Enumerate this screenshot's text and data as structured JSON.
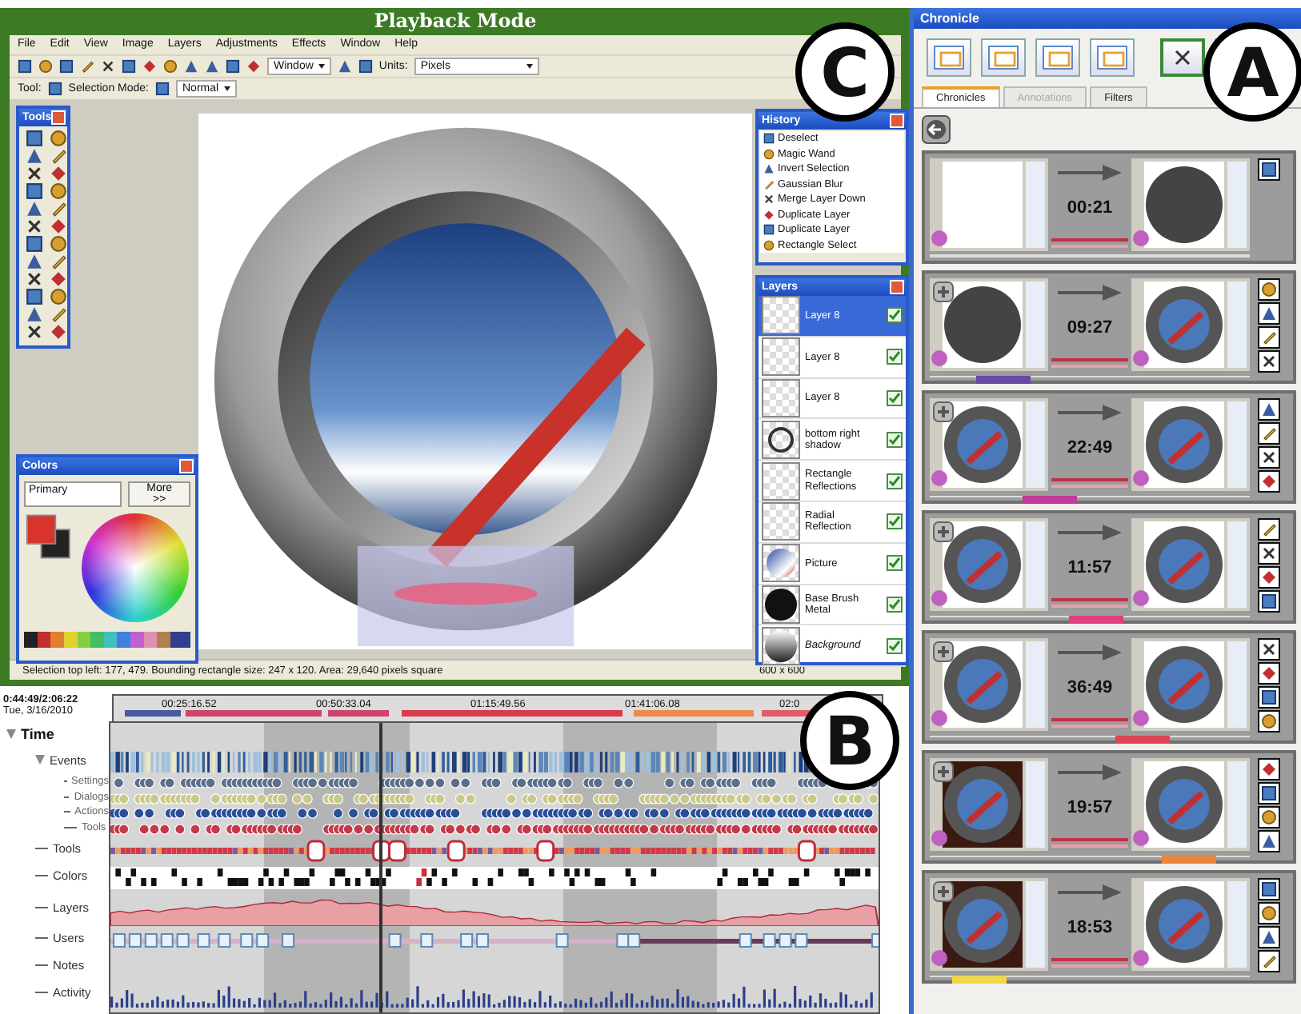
{
  "app": {
    "title": "Playback Mode",
    "menu": [
      "File",
      "Edit",
      "View",
      "Image",
      "Layers",
      "Adjustments",
      "Effects",
      "Window",
      "Help"
    ],
    "zoom_select": "Window",
    "units_label": "Units:",
    "units_select": "Pixels",
    "tool_label": "Tool:",
    "selection_mode_label": "Selection Mode:",
    "blend_select": "Normal",
    "tools_panel": {
      "title": "Tools"
    },
    "colors_panel": {
      "title": "Colors",
      "mode_select": "Primary",
      "more_button": "More >>"
    },
    "history_panel": {
      "title": "History",
      "items": [
        "Deselect",
        "Magic Wand",
        "Invert Selection",
        "Gaussian Blur",
        "Merge Layer Down",
        "Duplicate Layer",
        "Duplicate Layer",
        "Rectangle Select"
      ]
    },
    "layers_panel": {
      "title": "Layers",
      "layers": [
        {
          "name": "Layer 8",
          "selected": true,
          "visible": true,
          "kind": "layer"
        },
        {
          "name": "Layer 8",
          "selected": false,
          "visible": true,
          "kind": "layer"
        },
        {
          "name": "Layer 8",
          "selected": false,
          "visible": true,
          "kind": "layer"
        },
        {
          "name": "bottom right shadow",
          "selected": false,
          "visible": true,
          "kind": "ring"
        },
        {
          "name": "Rectangle Reflections",
          "selected": false,
          "visible": true,
          "kind": "layer"
        },
        {
          "name": "Radial Reflection",
          "selected": false,
          "visible": true,
          "kind": "layer"
        },
        {
          "name": "Picture",
          "selected": false,
          "visible": true,
          "kind": "picture"
        },
        {
          "name": "Base Brush Metal",
          "selected": false,
          "visible": true,
          "kind": "disc"
        },
        {
          "name": "Background",
          "selected": false,
          "visible": true,
          "kind": "background"
        }
      ]
    },
    "status_bar": {
      "selection_info": "Selection top left: 177, 479. Bounding rectangle size: 247 x 120. Area: 29,640 pixels square",
      "image_size": "600 x 600"
    }
  },
  "timeline": {
    "current_time": "0:44:49/2:06:22",
    "date": "Tue, 3/16/2010",
    "ticks": [
      "00:25:16.52",
      "00:50:33.04",
      "01:15:49.56",
      "01:41:06.08",
      "02:0"
    ],
    "tracks": [
      {
        "label": "Time",
        "kind": "group",
        "expanded": true,
        "children": [
          {
            "label": "Events",
            "kind": "events",
            "expanded": true,
            "children": [
              {
                "label": "Settings",
                "kind": "dots"
              },
              {
                "label": "Dialogs",
                "kind": "dots"
              },
              {
                "label": "Actions",
                "kind": "dots"
              },
              {
                "label": "Tools",
                "kind": "dots"
              }
            ]
          },
          {
            "label": "Tools",
            "kind": "tools"
          },
          {
            "label": "Colors",
            "kind": "colors"
          },
          {
            "label": "Layers",
            "kind": "layers"
          },
          {
            "label": "Users",
            "kind": "users"
          },
          {
            "label": "Notes",
            "kind": "notes"
          },
          {
            "label": "Activity",
            "kind": "activity"
          }
        ]
      }
    ]
  },
  "chronicle": {
    "title": "Chronicle",
    "tabs": [
      {
        "label": "Chronicles",
        "selected": true,
        "disabled": false
      },
      {
        "label": "Annotations",
        "selected": false,
        "disabled": true
      },
      {
        "label": "Filters",
        "selected": false,
        "disabled": false
      }
    ],
    "cards": [
      {
        "duration": "00:21",
        "kind": "first"
      },
      {
        "duration": "09:27",
        "kind": "step",
        "color": "#6a4aa8"
      },
      {
        "duration": "22:49",
        "kind": "step",
        "color": "#c0399b"
      },
      {
        "duration": "11:57",
        "kind": "step",
        "color": "#e0407c"
      },
      {
        "duration": "36:49",
        "kind": "step",
        "color": "#e04452"
      },
      {
        "duration": "19:57",
        "kind": "step",
        "color": "#e8873a"
      },
      {
        "duration": "18:53",
        "kind": "step",
        "color": "#f2d64a"
      }
    ]
  },
  "callouts": [
    "C",
    "A",
    "B"
  ]
}
